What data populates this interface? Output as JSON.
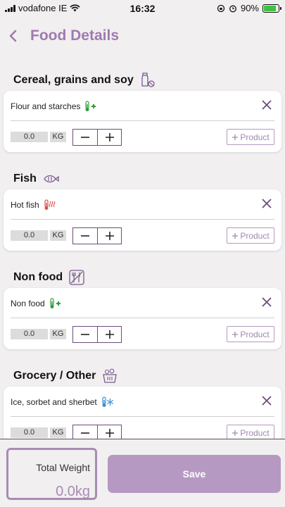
{
  "status_bar": {
    "carrier": "vodafone IE",
    "time": "16:32",
    "battery": "90%"
  },
  "header": {
    "title": "Food Details",
    "back_icon": "chevron-left-icon"
  },
  "sections": [
    {
      "title": "Cereal, grains and soy",
      "icon": "bottles-icon",
      "item": {
        "name": "Flour and starches",
        "temp_icon": "thermometer-plus-icon",
        "quantity": "0.0",
        "unit": "KG",
        "add_label": "Product"
      }
    },
    {
      "title": "Fish",
      "icon": "fish-icon",
      "item": {
        "name": "Hot fish",
        "temp_icon": "thermometer-hot-icon",
        "quantity": "0.0",
        "unit": "KG",
        "add_label": "Product"
      }
    },
    {
      "title": "Non food",
      "icon": "no-cutlery-icon",
      "item": {
        "name": "Non food",
        "temp_icon": "thermometer-plus-icon",
        "quantity": "0.0",
        "unit": "KG",
        "add_label": "Product"
      }
    },
    {
      "title": "Grocery / Other",
      "icon": "basket-icon",
      "item": {
        "name": "Ice, sorbet and sherbet",
        "temp_icon": "thermometer-cold-icon",
        "quantity": "0.0",
        "unit": "KG",
        "add_label": "Product"
      }
    }
  ],
  "footer": {
    "total_label": "Total Weight",
    "total_value": "0.0kg",
    "save_label": "Save"
  },
  "colors": {
    "accent": "#a07ab0",
    "stepper_border": "#6b4d7c",
    "save_button": "#b699c2",
    "thermo_green": "#2e9e3a",
    "thermo_red": "#d9534f",
    "thermo_blue": "#3b8fd6"
  }
}
